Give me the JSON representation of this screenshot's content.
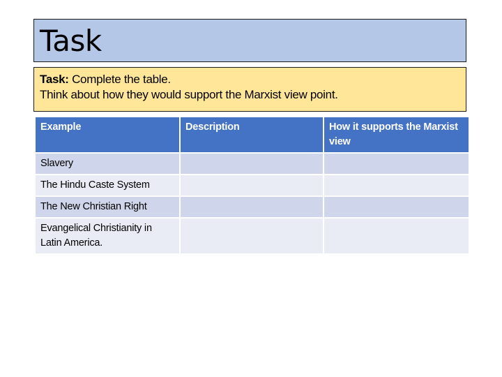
{
  "slide": {
    "title": "Task",
    "task_box": {
      "label": "Task:",
      "instruction": " Complete the table.",
      "prompt": "Think about how they would support the Marxist view point."
    },
    "table": {
      "headers": [
        "Example",
        "Description",
        "How it supports the Marxist view"
      ],
      "rows": [
        {
          "example": "Slavery",
          "description": "",
          "support": ""
        },
        {
          "example": "The Hindu Caste System",
          "description": "",
          "support": ""
        },
        {
          "example": "The New Christian Right",
          "description": "",
          "support": ""
        },
        {
          "example": "Evangelical Christianity in Latin America.",
          "description": "",
          "support": ""
        }
      ]
    },
    "colors": {
      "title_fill": "#B4C7E7",
      "task_fill": "#FFE699",
      "header_fill": "#4472C4",
      "row_band_dark": "#CFD5EA",
      "row_band_light": "#E9EBF5"
    }
  }
}
